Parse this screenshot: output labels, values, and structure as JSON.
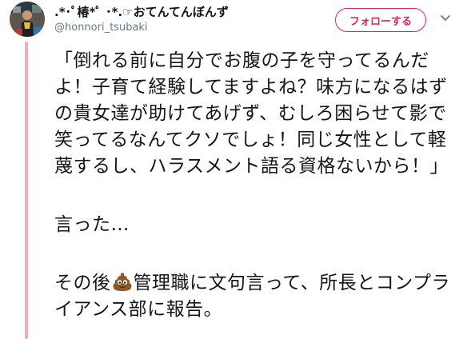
{
  "user": {
    "display_name": ".*･ﾟ椿*ﾟ  ･*.☞おてんてんぼんず",
    "screen_name": "@honnori_tsubaki"
  },
  "actions": {
    "follow_label": "フォローする"
  },
  "tweet": {
    "paragraph1": "「倒れる前に自分でお腹の子を守ってるんだよ！子育て経験してますよね？味方になるはずの貴女達が助けてあげず、むしろ困らせて影で笑ってるなんてクソでしょ！同じ女性として軽蔑するし、ハラスメント語る資格ないから！」",
    "paragraph2": "言った…",
    "paragraph3_before": "その後",
    "paragraph3_after": "管理職に文句言って、所長とコンプライアンス部に報告。",
    "emoji_icon": "pile-of-poo-icon"
  },
  "colors": {
    "accent": "#e0245e",
    "thread_line": "#f0aac4",
    "text": "#14171a",
    "secondary_text": "#657786"
  }
}
